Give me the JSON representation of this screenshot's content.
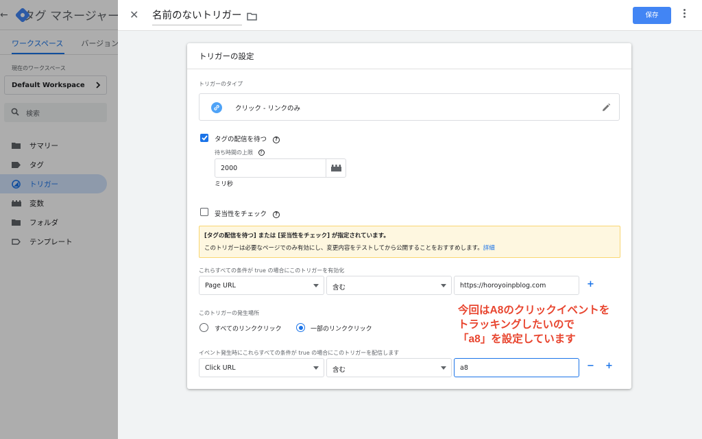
{
  "app": {
    "title": "タグ マネージャー",
    "tabs": [
      "ワークスペース",
      "バージョン"
    ],
    "workspace_label": "現在のワークスペース",
    "workspace_name": "Default Workspace",
    "search_placeholder": "検索",
    "nav": [
      {
        "label": "サマリー",
        "icon": "folder-icon"
      },
      {
        "label": "タグ",
        "icon": "tag-icon"
      },
      {
        "label": "トリガー",
        "icon": "trigger-icon"
      },
      {
        "label": "変数",
        "icon": "variable-icon"
      },
      {
        "label": "フォルダ",
        "icon": "folder-icon"
      },
      {
        "label": "テンプレート",
        "icon": "template-icon"
      }
    ],
    "active_nav": "トリガー"
  },
  "panel": {
    "title": "名前のないトリガー",
    "save_label": "保存"
  },
  "card": {
    "title": "トリガーの設定",
    "type_label": "トリガーのタイプ",
    "type_value": "クリック - リンクのみ",
    "wait_checkbox": {
      "label": "タグの配信を待つ",
      "checked": true
    },
    "max_wait_label": "待ち時間の上限",
    "max_wait_value": "2000",
    "max_wait_unit": "ミリ秒",
    "validation_checkbox": {
      "label": "妥当性をチェック",
      "checked": false
    },
    "notice": {
      "title": "[タグの配信を待つ] または [妥当性をチェック] が指定されています。",
      "body": "このトリガーは必要なページでのみ有効にし、変更内容をテストしてから公開することをおすすめします。",
      "link": "詳細"
    },
    "enable_label": "これらすべての条件が true の場合にこのトリガーを有効化",
    "enable_condition": {
      "variable": "Page URL",
      "operator": "含む",
      "value": "https://horoyoinpblog.com"
    },
    "fire_on_label": "このトリガーの発生場所",
    "fire_on_options": [
      "すべてのリンククリック",
      "一部のリンククリック"
    ],
    "fire_on_selected": "一部のリンククリック",
    "event_label": "イベント発生時にこれらすべての条件が true の場合にこのトリガーを配信します",
    "event_condition": {
      "variable": "Click URL",
      "operator": "含む",
      "value": "a8"
    },
    "plus": "+",
    "minus": "−"
  },
  "annotation": {
    "lines": [
      "今回はA8のクリックイベントを",
      "トラッキングしたいので",
      "「a8」を設定しています"
    ],
    "color": "#e8452f"
  },
  "colors": {
    "accent": "#1a73e8",
    "save_button": "#4285f4",
    "notice_bg": "#fef7e0"
  }
}
